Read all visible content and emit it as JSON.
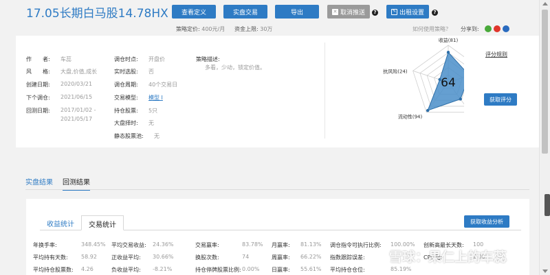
{
  "header": {
    "title": "17.05长期白马股14.78HX",
    "buttons": {
      "view_definition": "查看定义",
      "live_trade": "实盘交易",
      "export": "导出",
      "cancel_push": "取消推送",
      "rent_settings": "出租设置"
    },
    "price_label": "策略定价:",
    "price_value": "400元/月",
    "cap_label": "资金上限:",
    "cap_value": "30万",
    "how_to_use": "如何使用策略？",
    "share_label": "分享到:",
    "share_colors": [
      "#49a93a",
      "#e0352b",
      "#2a6bbf"
    ]
  },
  "details": {
    "author": {
      "label": "作　　者:",
      "value": "车蕊"
    },
    "style": {
      "label": "风　　格:",
      "value": "大盘,价值,成长"
    },
    "created": {
      "label": "创建日期:",
      "value": "2020/03/21"
    },
    "next_rebal": {
      "label": "下个调仓:",
      "value": "2021/06/15"
    },
    "backtest": {
      "label": "回测日期:",
      "value": "2017/01/02 -",
      "value2": "2021/05/17"
    },
    "rebal_time": {
      "label": "调仓时点:",
      "value": "开盘价"
    },
    "realtime": {
      "label": "实时选股:",
      "value": "否"
    },
    "rebal_cycle": {
      "label": "调仓周期:",
      "value": "40个交易日"
    },
    "trade_model": {
      "label": "交易模型:",
      "value": "模型 I"
    },
    "holdings": {
      "label": "持仓股票:",
      "value": "5只"
    },
    "timing": {
      "label": "大盘择时:",
      "value": "无"
    },
    "static_pool": {
      "label": "静态股票池:",
      "value": "无"
    },
    "desc_label": "策略描述:",
    "desc_text": "多看，少动，锁定价值。"
  },
  "radar": {
    "score": "64",
    "axes": [
      {
        "label": "收益(81)",
        "value": 81
      },
      {
        "label": "深度(60)",
        "value": 60
      },
      {
        "label": "稳定性(56)",
        "value": 56
      },
      {
        "label": "流动性(94)",
        "value": 94
      },
      {
        "label": "抗风险(24)",
        "value": 24
      }
    ],
    "rule_link": "评分规则",
    "get_score": "获取评分",
    "fill_color": "#4a8ec9",
    "line_color": "#2e6fa8"
  },
  "tabs": {
    "live": "实盘结果",
    "backtest": "回测结果"
  },
  "stats_tabs": {
    "profit": "收益统计",
    "trade": "交易统计",
    "profit_btn": "获取收益分析"
  },
  "stats": [
    [
      {
        "label": "年换手率:",
        "value": "348.45%"
      },
      {
        "label": "平均交易收益:",
        "value": "24.36%"
      },
      {
        "label": "交易赢率:",
        "value": "83.78%"
      },
      {
        "label": "月赢率:",
        "value": "81.13%"
      },
      {
        "label": "调仓指令可执行比例:",
        "value": "100.00%"
      },
      {
        "label": "创新高最长天数:",
        "value": "100"
      }
    ],
    [
      {
        "label": "平均持有天数:",
        "value": "58.92"
      },
      {
        "label": "正收益平均:",
        "value": "30.66%"
      },
      {
        "label": "换股次数:",
        "value": "74"
      },
      {
        "label": "周赢率:",
        "value": "66.22%"
      },
      {
        "label": "指数跟踪误差:",
        "value": ""
      },
      {
        "label": "CPU配:",
        "value": "2.00"
      }
    ],
    [
      {
        "label": "平均持仓股票数:",
        "value": "4.26"
      },
      {
        "label": "负收益平均:",
        "value": "-8.21%"
      },
      {
        "label": "持仓停牌股票比例:",
        "value": "0.00%"
      },
      {
        "label": "日赢率:",
        "value": "55.61%"
      },
      {
        "label": "平均持仓仓位:",
        "value": "85.19%"
      },
      {
        "label": "",
        "value": ""
      }
    ]
  ],
  "watermark": "雪球：果仁上的车蕊"
}
